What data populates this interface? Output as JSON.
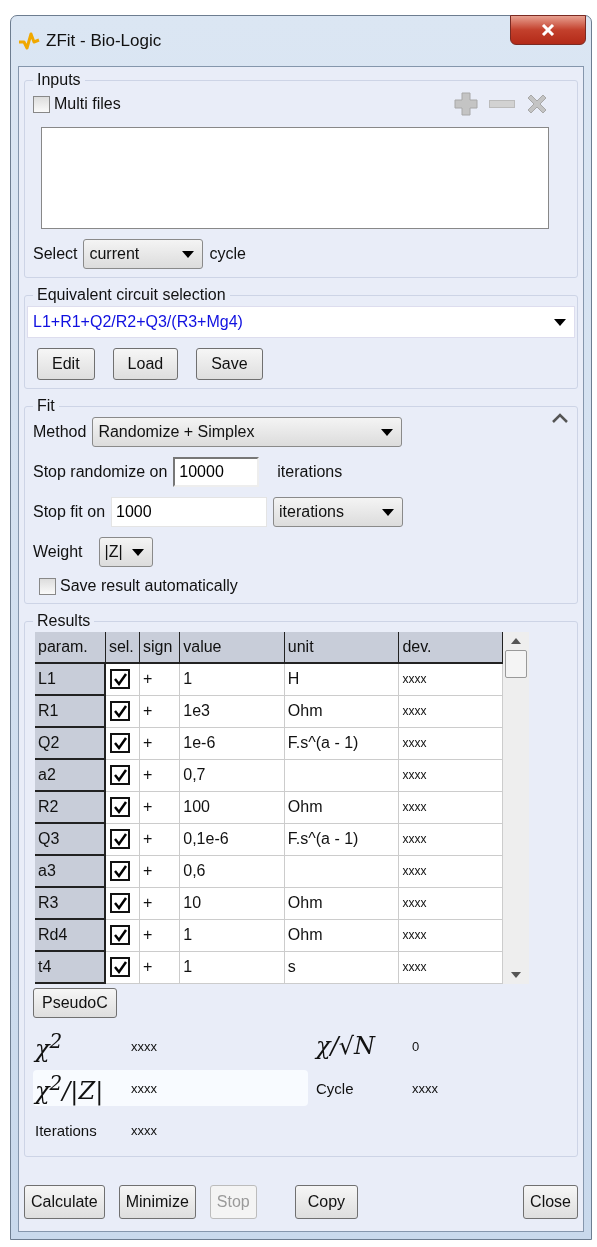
{
  "window": {
    "title": "ZFit - Bio-Logic"
  },
  "inputs": {
    "title": "Inputs",
    "multi_files": {
      "label": "Multi files",
      "checked": false
    },
    "select_label": "Select",
    "select_value": "current",
    "cycle_label": "cycle"
  },
  "circuit": {
    "title": "Equivalent circuit selection",
    "value": "L1+R1+Q2/R2+Q3/(R3+Mg4)",
    "buttons": [
      {
        "label": "Edit"
      },
      {
        "label": "Load"
      },
      {
        "label": "Save"
      }
    ]
  },
  "fit": {
    "title": "Fit",
    "expanded": true,
    "method_label": "Method",
    "method": "Randomize + Simplex",
    "randomize_label": "Stop randomize on",
    "randomize_value": "10000",
    "randomize_unit": "iterations",
    "stop_fit_label": "Stop fit on",
    "stop_fit_value": "1000",
    "stop_fit_unit": "iterations",
    "weight_label": "Weight",
    "weight": "|Z|",
    "save_auto": {
      "label": "Save result automatically",
      "checked": false
    }
  },
  "results": {
    "title": "Results",
    "columns": [
      "param.",
      "sel.",
      "sign",
      "value",
      "unit",
      "dev."
    ],
    "rows": [
      {
        "param": "L1",
        "checked": true,
        "sign": "+",
        "value": "1",
        "unit": "H",
        "dev": "xxxx"
      },
      {
        "param": "R1",
        "checked": true,
        "sign": "+",
        "value": "1e3",
        "unit": "Ohm",
        "dev": "xxxx"
      },
      {
        "param": "Q2",
        "checked": true,
        "sign": "+",
        "value": "1e-6",
        "unit": "F.s^(a - 1)",
        "dev": "xxxx"
      },
      {
        "param": "a2",
        "checked": true,
        "sign": "+",
        "value": "0,7",
        "unit": "",
        "dev": "xxxx"
      },
      {
        "param": "R2",
        "checked": true,
        "sign": "+",
        "value": "100",
        "unit": "Ohm",
        "dev": "xxxx"
      },
      {
        "param": "Q3",
        "checked": true,
        "sign": "+",
        "value": "0,1e-6",
        "unit": "F.s^(a - 1)",
        "dev": "xxxx"
      },
      {
        "param": "a3",
        "checked": true,
        "sign": "+",
        "value": "0,6",
        "unit": "",
        "dev": "xxxx"
      },
      {
        "param": "R3",
        "checked": true,
        "sign": "+",
        "value": "10",
        "unit": "Ohm",
        "dev": "xxxx"
      },
      {
        "param": "Rd4",
        "checked": true,
        "sign": "+",
        "value": "1",
        "unit": "Ohm",
        "dev": "xxxx"
      },
      {
        "param": "t4",
        "checked": true,
        "sign": "+",
        "value": "1",
        "unit": "s",
        "dev": "xxxx"
      }
    ],
    "pseudo_button": "PseudoC",
    "stats": [
      {
        "kind": "math",
        "label": "χ$^{2}$",
        "value": "xxxx",
        "highlighted": false
      },
      {
        "kind": "math",
        "label": "χ/√N",
        "value": "0",
        "highlighted": false
      },
      {
        "kind": "math",
        "label": "χ$^{2}$/|Z|",
        "value": "xxxx",
        "highlighted": true
      },
      {
        "kind": "text",
        "label": "Cycle",
        "value": "xxxx",
        "highlighted": false
      },
      {
        "kind": "text",
        "label": "Iterations",
        "value": "xxxx",
        "highlighted": false
      }
    ]
  },
  "buttons": [
    {
      "label": "Calculate",
      "disabled": false
    },
    {
      "label": "Minimize",
      "disabled": false
    },
    {
      "label": "Stop",
      "disabled": true
    },
    {
      "label": "Copy",
      "disabled": false
    },
    {
      "label": "Close",
      "disabled": false
    }
  ]
}
